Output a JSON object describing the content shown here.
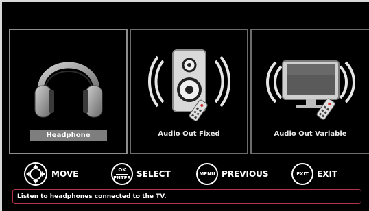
{
  "tiles": [
    {
      "label": "Headphone",
      "icon": "headphone-icon",
      "selected": true
    },
    {
      "label": "Audio Out Fixed",
      "icon": "speaker-remote-icon",
      "selected": false
    },
    {
      "label": "Audio Out Variable",
      "icon": "tv-remote-icon",
      "selected": false
    }
  ],
  "hints": {
    "move": {
      "label": "MOVE",
      "icon": "dpad-icon"
    },
    "select": {
      "label": "SELECT",
      "key_top": "OK",
      "key_bottom": "ENTER"
    },
    "previous": {
      "label": "PREVIOUS",
      "key": "MENU"
    },
    "exit": {
      "label": "EXIT",
      "key": "EXIT"
    }
  },
  "status": {
    "text": "Listen to headphones connected to the TV."
  },
  "colors": {
    "background": "#000000",
    "selected_label_bg": "#7e7e7e",
    "status_border": "#b0344a"
  }
}
